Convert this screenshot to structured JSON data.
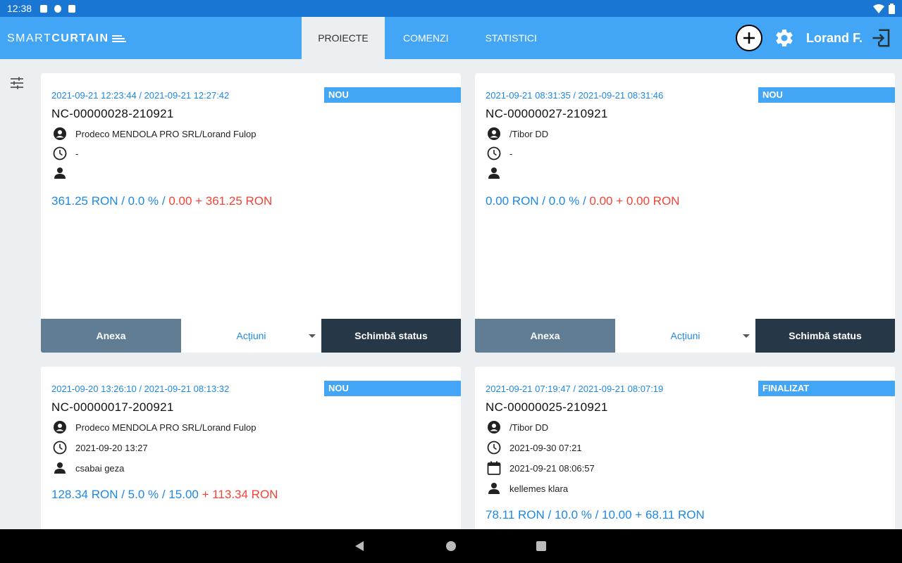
{
  "status_bar": {
    "time": "12:38"
  },
  "app": {
    "logo_light": "SMART",
    "logo_bold": "CURTAIN",
    "tabs": [
      {
        "label": "PROIECTE",
        "active": true
      },
      {
        "label": "COMENZI",
        "active": false
      },
      {
        "label": "STATISTICI",
        "active": false
      }
    ],
    "user_name": "Lorand F."
  },
  "cards": [
    {
      "dates": "2021-09-21 12:23:44 / 2021-09-21 12:27:42",
      "badge": "NOU",
      "code": "NC-00000028-210921",
      "client": "Prodeco MENDOLA PRO SRL/Lorand Fulop",
      "deadline": "-",
      "finished": "",
      "person": "",
      "price_blue": "361.25 RON / 0.0 % / ",
      "price_red": "0.00 + 361.25 RON",
      "anexa": "Anexa",
      "actiuni": "Acțiuni",
      "status_btn": "Schimbă status"
    },
    {
      "dates": "2021-09-21 08:31:35 / 2021-09-21 08:31:46",
      "badge": "NOU",
      "code": "NC-00000027-210921",
      "client": "/Tibor DD",
      "deadline": "-",
      "finished": "",
      "person": "",
      "price_blue": "0.00 RON / 0.0 % / ",
      "price_red": "0.00 + 0.00 RON",
      "anexa": "Anexa",
      "actiuni": "Acțiuni",
      "status_btn": "Schimbă status"
    },
    {
      "dates": "2021-09-20 13:26:10 / 2021-09-21 08:13:32",
      "badge": "NOU",
      "code": "NC-00000017-200921",
      "client": "Prodeco MENDOLA PRO SRL/Lorand Fulop",
      "deadline": "2021-09-20 13:27",
      "finished": "",
      "person": "csabai geza",
      "price_blue": "128.34 RON / 5.0 % / 15.00 ",
      "price_red": "+ 113.34 RON"
    },
    {
      "dates": "2021-09-21 07:19:47 / 2021-09-21 08:07:19",
      "badge": "FINALIZAT",
      "code": "NC-00000025-210921",
      "client": "/Tibor DD",
      "deadline": "2021-09-30 07:21",
      "finished": "2021-09-21 08:06:57",
      "person": "kellemes klara",
      "price_blue": "78.11 RON / 10.0 % / 10.00 + 68.11 RON",
      "price_red": ""
    }
  ]
}
